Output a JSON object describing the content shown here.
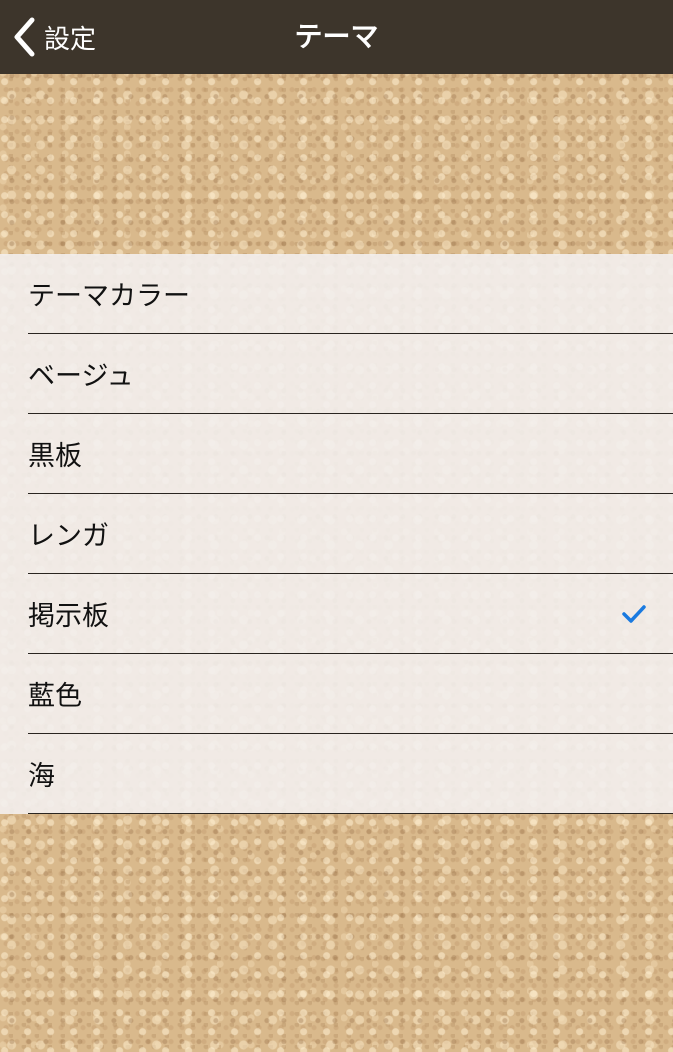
{
  "navbar": {
    "back_label": "設定",
    "title": "テーマ"
  },
  "theme_list": {
    "header": "テーマカラー",
    "items": [
      {
        "label": "ベージュ",
        "selected": false
      },
      {
        "label": "黒板",
        "selected": false
      },
      {
        "label": "レンガ",
        "selected": false
      },
      {
        "label": "掲示板",
        "selected": true
      },
      {
        "label": "藍色",
        "selected": false
      },
      {
        "label": "海",
        "selected": false
      }
    ]
  },
  "colors": {
    "navbar_bg": "#3d352b",
    "checkmark": "#1a7ae0",
    "list_bg": "#f3f0ee"
  },
  "icons": {
    "back": "chevron-left-icon",
    "selected": "checkmark-icon"
  }
}
